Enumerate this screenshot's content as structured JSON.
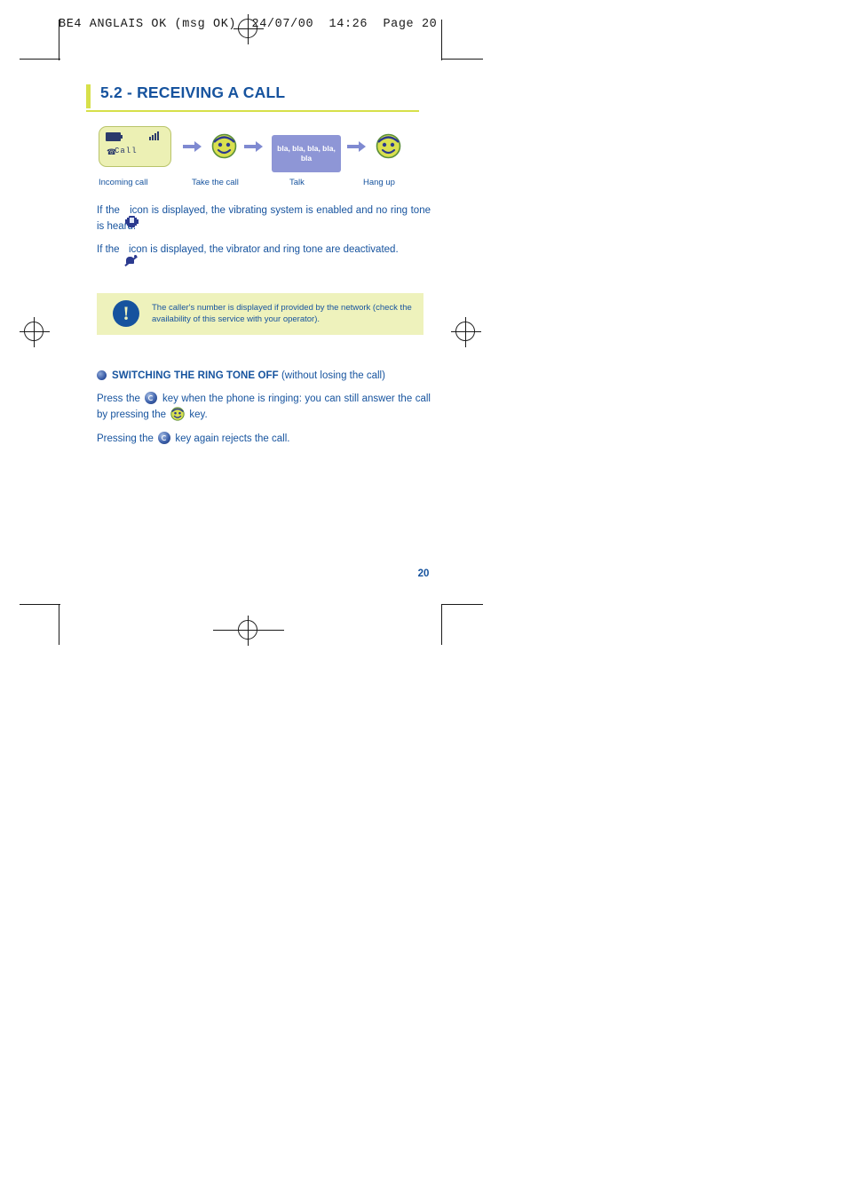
{
  "header": {
    "line": "BE4 ANGLAIS OK (msg OK)  24/07/00  14:26  Page 20"
  },
  "section": {
    "number": "5.2",
    "title": "5.2 - RECEIVING A CALL"
  },
  "sequence": {
    "screen_label": "Call",
    "talk_text": "bla, bla, bla, bla, bla",
    "captions": [
      "Incoming call",
      "Take the call",
      "Talk",
      "Hang up"
    ]
  },
  "paragraphs": {
    "vibrate": {
      "before": "If the",
      "after": "icon is displayed, the vibrating system is enabled and no ring tone is heard."
    },
    "mute": {
      "before": "If the",
      "after": "icon is displayed, the vibrator and ring tone are deactivated."
    }
  },
  "note": {
    "icon": "exclamation-icon",
    "glyph": "!",
    "text": "The caller's number is displayed if provided by the network (check the availability of this service with your operator)."
  },
  "subsection": {
    "heading_strong": "SWITCHING THE RING TONE OFF",
    "heading_normal": "(without losing the call)",
    "body1_a": "Press the",
    "body1_b": "key when the phone is ringing: you can still answer the call by pressing the",
    "body1_c": "key.",
    "body2_a": "Pressing the",
    "body2_b": "key again rejects the call."
  },
  "page_number": "20",
  "colors": {
    "accent_blue": "#16539e",
    "accent_lime": "#d7e04a",
    "screen_bg": "#ecf0b4",
    "talk_bg": "#8e96d6",
    "note_bg": "#eef2bc"
  }
}
